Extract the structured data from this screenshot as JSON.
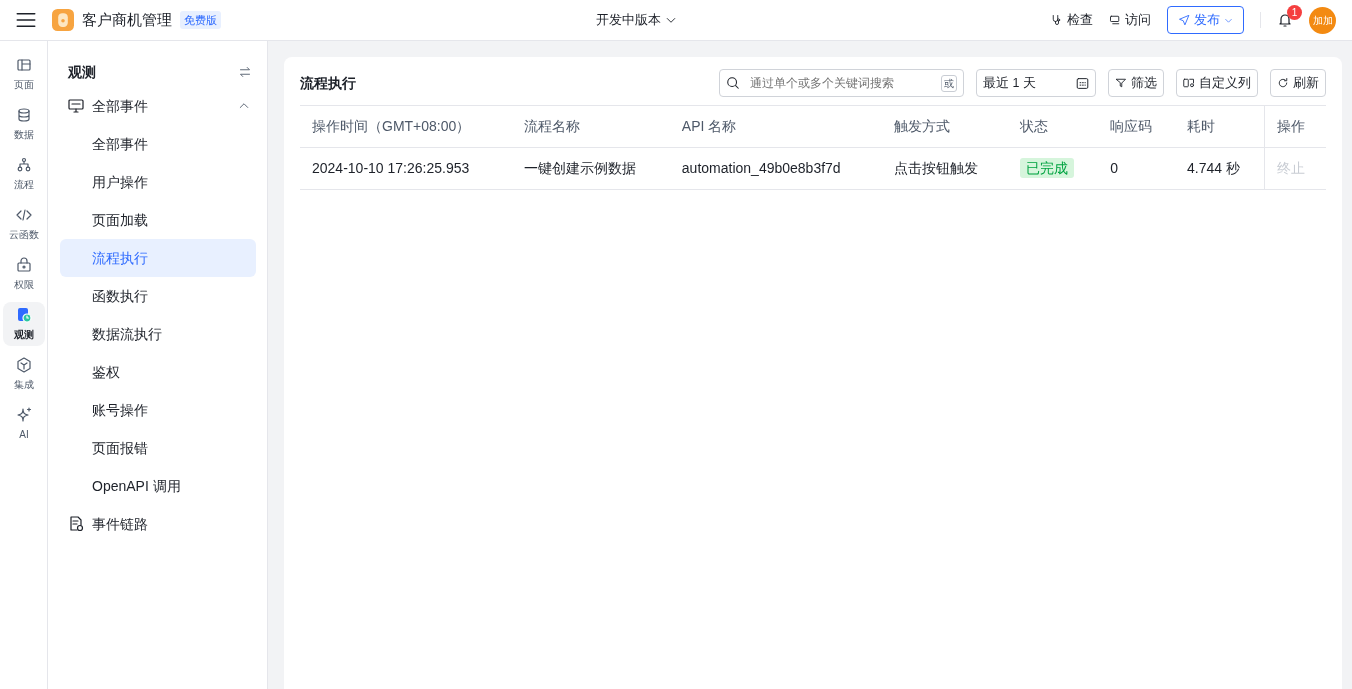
{
  "header": {
    "app_name": "客户商机管理",
    "plan_badge": "免费版",
    "version": "开发中版本",
    "actions": [
      "检查",
      "访问"
    ],
    "publish": "发布",
    "notifications": "1",
    "avatar": "加加"
  },
  "rail": [
    {
      "label": "页面",
      "selected": false
    },
    {
      "label": "数据",
      "selected": false
    },
    {
      "label": "流程",
      "selected": false
    },
    {
      "label": "云函数",
      "selected": false
    },
    {
      "label": "权限",
      "selected": false
    },
    {
      "label": "观测",
      "selected": true
    },
    {
      "label": "集成",
      "selected": false
    },
    {
      "label": "AI",
      "selected": false
    }
  ],
  "sidebar": {
    "title": "观测",
    "items": [
      {
        "label": "全部事件",
        "expanded": true,
        "children": [
          {
            "label": "全部事件",
            "selected": false
          },
          {
            "label": "用户操作",
            "selected": false
          },
          {
            "label": "页面加载",
            "selected": false
          },
          {
            "label": "流程执行",
            "selected": true
          },
          {
            "label": "函数执行",
            "selected": false
          },
          {
            "label": "数据流执行",
            "selected": false
          },
          {
            "label": "鉴权",
            "selected": false
          },
          {
            "label": "账号操作",
            "selected": false
          },
          {
            "label": "页面报错",
            "selected": false
          },
          {
            "label": "OpenAPI 调用",
            "selected": false
          }
        ]
      },
      {
        "label": "事件链路"
      }
    ]
  },
  "panel": {
    "title": "流程执行",
    "search": {
      "placeholder": "通过单个或多个关键词搜索",
      "mode": "或"
    },
    "range": "最近 1 天",
    "buttons": [
      "筛选",
      "自定义列",
      "刷新"
    ],
    "table": {
      "columns": [
        "操作时间（GMT+08:00）",
        "流程名称",
        "API 名称",
        "触发方式",
        "状态",
        "响应码",
        "耗时",
        "操作"
      ],
      "rows": [
        {
          "time": "2024-10-10 17:26:25.953",
          "flow": "一键创建示例数据",
          "api": "automation_49b0e8b3f7d",
          "trigger": "点击按钮触发",
          "status": "已完成",
          "code": "0",
          "duration": "4.744 秒",
          "action": "终止",
          "action_disabled": true
        }
      ]
    }
  }
}
